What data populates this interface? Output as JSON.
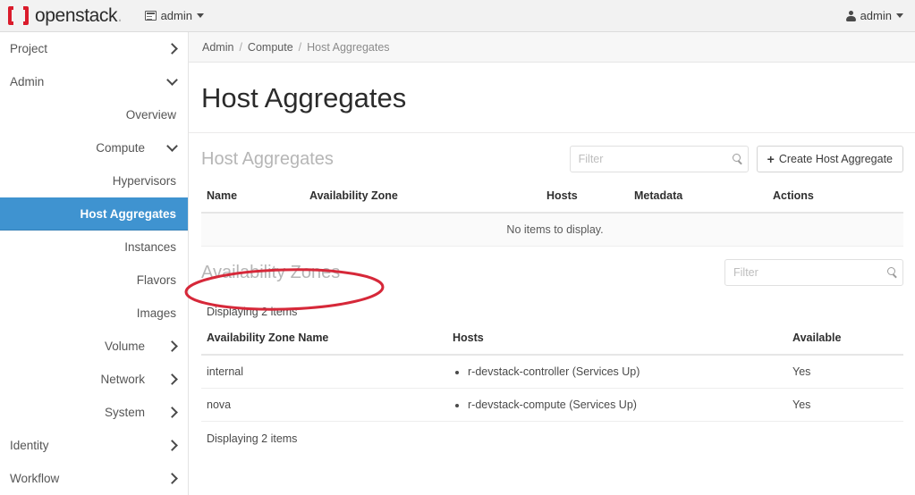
{
  "navbar": {
    "brand": "openstack",
    "brand_dot": ".",
    "project_selector": "admin",
    "project_icon": "project-list-icon",
    "user_name": "admin",
    "user_icon": "user-icon"
  },
  "sidebar": {
    "items": [
      {
        "label": "Project",
        "level": 1,
        "chevron": "right",
        "active": false
      },
      {
        "label": "Admin",
        "level": 1,
        "chevron": "down",
        "active": false
      },
      {
        "label": "Overview",
        "level": 3,
        "chevron": "",
        "active": false
      },
      {
        "label": "Compute",
        "level": 2,
        "chevron": "down",
        "active": false
      },
      {
        "label": "Hypervisors",
        "level": 3,
        "chevron": "",
        "active": false
      },
      {
        "label": "Host Aggregates",
        "level": 3,
        "chevron": "",
        "active": true
      },
      {
        "label": "Instances",
        "level": 3,
        "chevron": "",
        "active": false
      },
      {
        "label": "Flavors",
        "level": 3,
        "chevron": "",
        "active": false
      },
      {
        "label": "Images",
        "level": 3,
        "chevron": "",
        "active": false
      },
      {
        "label": "Volume",
        "level": 2,
        "chevron": "right",
        "active": false
      },
      {
        "label": "Network",
        "level": 2,
        "chevron": "right",
        "active": false
      },
      {
        "label": "System",
        "level": 2,
        "chevron": "right",
        "active": false
      },
      {
        "label": "Identity",
        "level": 1,
        "chevron": "right",
        "active": false
      },
      {
        "label": "Workflow",
        "level": 1,
        "chevron": "right",
        "active": false
      }
    ]
  },
  "breadcrumb": {
    "items": [
      "Admin",
      "Compute",
      "Host Aggregates"
    ],
    "separator": "/"
  },
  "page": {
    "title": "Host Aggregates"
  },
  "host_aggregates": {
    "section_title": "Host Aggregates",
    "filter_placeholder": "Filter",
    "filter_value": "",
    "search_icon": "search-icon",
    "create_button": "Create Host Aggregate",
    "create_icon": "plus-icon",
    "columns": [
      "Name",
      "Availability Zone",
      "Hosts",
      "Metadata",
      "Actions"
    ],
    "empty_message": "No items to display."
  },
  "availability_zones": {
    "section_title": "Availability Zones",
    "filter_placeholder": "Filter",
    "filter_value": "",
    "search_icon": "search-icon",
    "count_top": "Displaying 2 items",
    "count_bottom": "Displaying 2 items",
    "columns": [
      "Availability Zone Name",
      "Hosts",
      "Available"
    ],
    "rows": [
      {
        "name": "internal",
        "hosts": [
          "r-devstack-controller (Services Up)"
        ],
        "available": "Yes"
      },
      {
        "name": "nova",
        "hosts": [
          "r-devstack-compute (Services Up)"
        ],
        "available": "Yes"
      }
    ]
  },
  "annotation": {
    "shape": "ellipse",
    "color": "#d62839",
    "targets": "Availability Zones"
  },
  "colors": {
    "accent_blue": "#3f93d0",
    "brand_red": "#da1b2b",
    "annotation_red": "#d62839"
  }
}
